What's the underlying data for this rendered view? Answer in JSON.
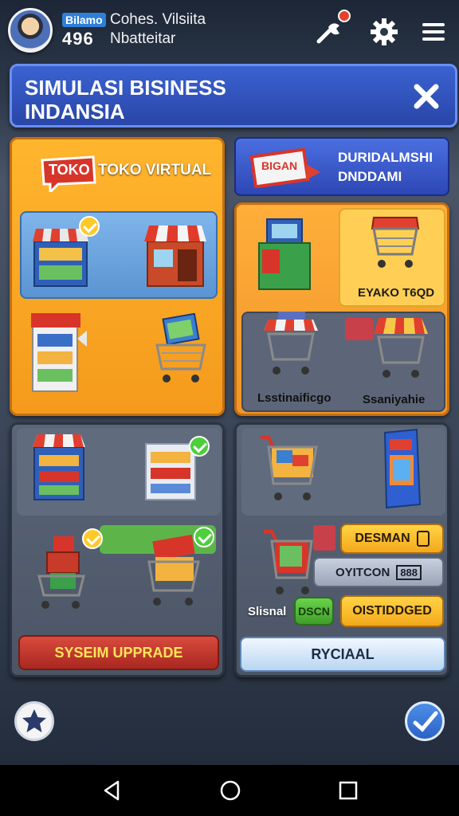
{
  "player": {
    "badge": "Bilamo",
    "score": "496",
    "name": "Cohes. Vilsiita",
    "subtitle": "Nbatteitar"
  },
  "banner": {
    "title": "SIMULASI BISINESS INDANSIA"
  },
  "panels": {
    "toko": {
      "tag": "TOKO",
      "label": "TOKO VIRTUAL"
    },
    "top_right_button": {
      "label": "DURIDALMSHI DNDDAMI"
    },
    "right_orange": {
      "featured_label": "EYAKO T6QD",
      "caption_left": "Lsstinaificgo",
      "caption_right": "Ssaniyahie",
      "sign": "BIGAN"
    },
    "system_upgrade": {
      "label": "SYSEIM UPPRADE"
    },
    "right_gray": {
      "desman": "DESMAN",
      "oyitcon": "OYITCON",
      "code": "888",
      "shenal": "Slisnal",
      "green_btn": "DSCN",
      "olstidoged": "OISTIDDGED",
      "rycial": "RYCIAAL"
    }
  },
  "colors": {
    "orange": "#f59a1c",
    "banner_blue": "#2946a8",
    "panel_gray": "#4b5566"
  },
  "icons": [
    "avatar",
    "wrench-icon",
    "gear-icon",
    "menu-icon",
    "close-icon",
    "star-icon",
    "check-icon",
    "back-icon",
    "home-icon",
    "recent-icon"
  ]
}
